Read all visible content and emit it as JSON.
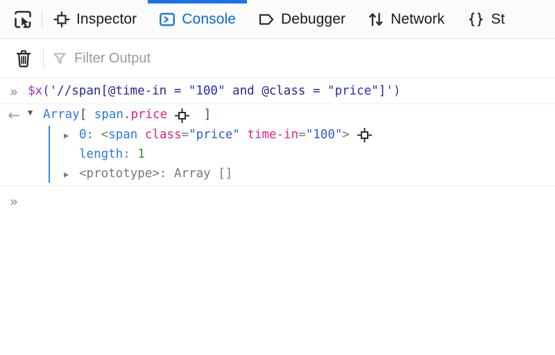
{
  "theme": {
    "accent": "#1a73e8",
    "active_tab_text": "#0a66d6",
    "background": "#ffffff",
    "toolbar_background": "#fbfbfb",
    "placeholder_color": "#9a9aa2",
    "tree_guide_color": "#2a8fe0"
  },
  "toolbar": {
    "picker_icon": "element-picker-icon",
    "tabs": [
      {
        "label": "Inspector",
        "icon": "inspector-square-icon",
        "active": false
      },
      {
        "label": "Console",
        "icon": "console-chevron-icon",
        "active": true
      },
      {
        "label": "Debugger",
        "icon": "debugger-tag-icon",
        "active": false
      },
      {
        "label": "Network",
        "icon": "network-arrows-icon",
        "active": false
      },
      {
        "label": "St",
        "icon": "style-editor-braces-icon",
        "active": false
      }
    ]
  },
  "filterbar": {
    "clear_icon": "trash-icon",
    "filter_icon": "funnel-icon",
    "filter_placeholder": "Filter Output",
    "filter_value": ""
  },
  "console": {
    "input_prompt": "»",
    "input_expression": {
      "fn": "$x",
      "open_paren": "(",
      "quote_open": "'",
      "xpath": "//span[@time-in = ",
      "str1": "\"100\"",
      "mid": " and @class = ",
      "str2": "\"price\"",
      "xpath_end": "]",
      "quote_close": "'",
      "close_paren": ")",
      "full": "$x('//span[@time-in = \"100\" and @class = \"price\"]')"
    },
    "result": {
      "return_arrow": "←",
      "twisty_open": "▼",
      "twisty_closed": "▶",
      "type_label": "Array",
      "bracket_open": "[",
      "bracket_close": "]",
      "preview_node": "span",
      "preview_class": ".price",
      "inspect_icon": "inspect-node-target-icon",
      "children": [
        {
          "twisty": "▶",
          "index": "0:",
          "node_open": "<",
          "tag": "span",
          "attr1_name": "class",
          "attr1_eq": "=",
          "attr1_value": "\"price\"",
          "attr2_name": "time-in",
          "attr2_eq": "=",
          "attr2_value": "\"100\"",
          "node_close": ">",
          "inspect_icon": "inspect-node-target-icon",
          "kind": "node"
        },
        {
          "key": "length",
          "colon": ":",
          "value": "1",
          "kind": "number"
        },
        {
          "twisty": "▶",
          "key": "<prototype>",
          "colon": ":",
          "value": "Array []",
          "kind": "prototype"
        }
      ]
    },
    "bottom_prompt": "»",
    "bottom_input_value": ""
  }
}
